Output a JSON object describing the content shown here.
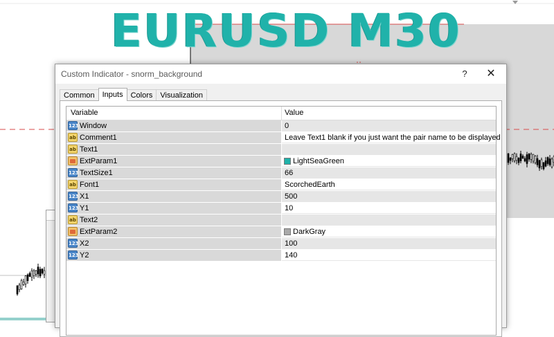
{
  "chart": {
    "overlay_title": "EURUSD M30",
    "overlay_color": "#20B2AA",
    "bid_line_color": "#d94a4a",
    "candle_color": "#000000"
  },
  "dialog": {
    "title": "Custom Indicator - snorm_background",
    "help_label": "?",
    "close_label": "✕",
    "tabs": [
      "Common",
      "Inputs",
      "Colors",
      "Visualization"
    ],
    "active_tab": "Inputs",
    "columns": {
      "variable": "Variable",
      "value": "Value"
    },
    "rows": [
      {
        "type": "int",
        "icon_text": "123",
        "variable": "Window",
        "value": "0"
      },
      {
        "type": "str",
        "icon_text": "ab",
        "variable": "Comment1",
        "value": "Leave Text1 blank if you just want the pair name to be displayed"
      },
      {
        "type": "str",
        "icon_text": "ab",
        "variable": "Text1",
        "value": ""
      },
      {
        "type": "clr",
        "icon_text": "",
        "variable": "ExtParam1",
        "value": "LightSeaGreen",
        "swatch": "#20B2AA"
      },
      {
        "type": "int",
        "icon_text": "123",
        "variable": "TextSize1",
        "value": "66"
      },
      {
        "type": "str",
        "icon_text": "ab",
        "variable": "Font1",
        "value": "ScorchedEarth"
      },
      {
        "type": "int",
        "icon_text": "123",
        "variable": "X1",
        "value": "500"
      },
      {
        "type": "int",
        "icon_text": "123",
        "variable": "Y1",
        "value": "10"
      },
      {
        "type": "str",
        "icon_text": "ab",
        "variable": "Text2",
        "value": ""
      },
      {
        "type": "clr",
        "icon_text": "",
        "variable": "ExtParam2",
        "value": "DarkGray",
        "swatch": "#A9A9A9"
      },
      {
        "type": "int",
        "icon_text": "123",
        "variable": "X2",
        "value": "100"
      },
      {
        "type": "int",
        "icon_text": "123",
        "variable": "Y2",
        "value": "140"
      }
    ]
  }
}
